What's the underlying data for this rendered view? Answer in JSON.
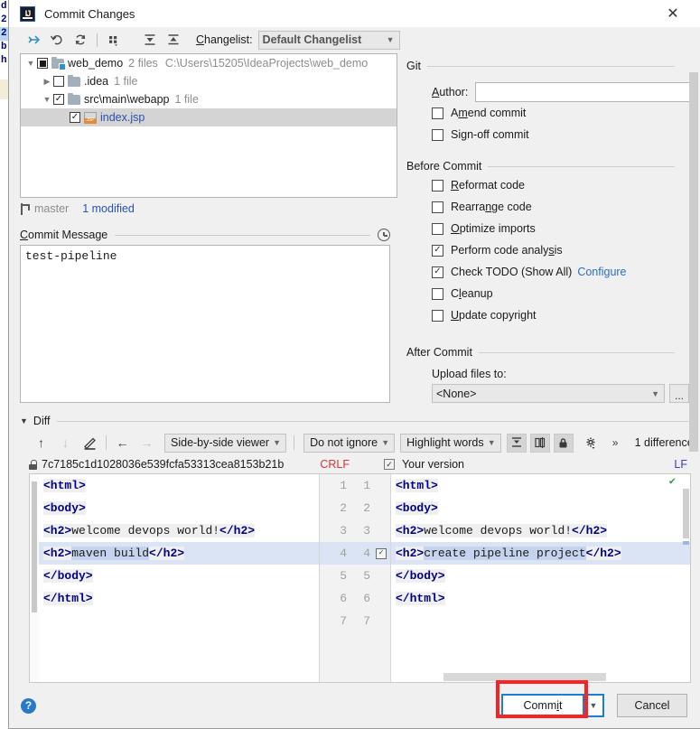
{
  "window": {
    "title": "Commit Changes",
    "app_icon": "intellij-idea-icon",
    "close_icon": "close-icon"
  },
  "background_editor": {
    "lines": [
      "d",
      "2",
      "2",
      "b",
      "h"
    ]
  },
  "toolbar": {
    "icons": [
      {
        "name": "expand-all-icon",
        "glyph": "include"
      },
      {
        "name": "rollback-icon",
        "glyph": "undo"
      },
      {
        "name": "refresh-icon",
        "glyph": "refresh"
      },
      {
        "name": "group-by-icon",
        "glyph": "group"
      },
      {
        "name": "expand-tree-icon",
        "glyph": "expand"
      },
      {
        "name": "collapse-tree-icon",
        "glyph": "collapse"
      }
    ],
    "changelist_label": "Changelist:",
    "changelist_accel": "C",
    "changelist_value": "Default Changelist"
  },
  "file_tree": {
    "rows": [
      {
        "indent": 0,
        "twisty": "v",
        "check": "partial",
        "icon": "folder-badge-icon",
        "name": "web_demo",
        "meta": "2 files",
        "path": "C:\\Users\\15205\\IdeaProjects\\web_demo",
        "selected": false,
        "link": false
      },
      {
        "indent": 1,
        "twisty": ">",
        "check": "off",
        "icon": "folder-icon",
        "name": ".idea",
        "meta": "1 file",
        "path": "",
        "selected": false,
        "link": false
      },
      {
        "indent": 1,
        "twisty": "v",
        "check": "on",
        "icon": "folder-icon",
        "name": "src\\main\\webapp",
        "meta": "1 file",
        "path": "",
        "selected": false,
        "link": false
      },
      {
        "indent": 2,
        "twisty": "",
        "check": "on",
        "icon": "jsp-file-icon",
        "name": "index.jsp",
        "meta": "",
        "path": "",
        "selected": true,
        "link": true
      }
    ]
  },
  "branch_bar": {
    "icon": "branch-icon",
    "branch": "master",
    "modified": "1 modified"
  },
  "commit_message": {
    "label": "Commit Message",
    "accel": "C",
    "history_icon": "clock-icon",
    "value": "test-pipeline"
  },
  "git_group": {
    "title": "Git",
    "author_label": "Author:",
    "author_accel": "A",
    "author_value": "",
    "options": [
      {
        "label": "Amend commit",
        "accel": "m",
        "checked": false,
        "name": "amend-commit-checkbox"
      },
      {
        "label": "Sign-off commit",
        "accel": "g",
        "checked": false,
        "name": "sign-off-commit-checkbox"
      }
    ]
  },
  "before_commit": {
    "title": "Before Commit",
    "options": [
      {
        "label": "Reformat code",
        "accel": "R",
        "checked": false,
        "name": "reformat-code-checkbox",
        "link": ""
      },
      {
        "label": "Rearrange code",
        "accel": "n",
        "checked": false,
        "name": "rearrange-code-checkbox",
        "link": ""
      },
      {
        "label": "Optimize imports",
        "accel": "O",
        "checked": false,
        "name": "optimize-imports-checkbox",
        "link": ""
      },
      {
        "label": "Perform code analysis",
        "accel": "s",
        "checked": true,
        "name": "perform-code-analysis-checkbox",
        "link": ""
      },
      {
        "label": "Check TODO (Show All)",
        "accel": "",
        "checked": true,
        "name": "check-todo-checkbox",
        "link": "Configure"
      },
      {
        "label": "Cleanup",
        "accel": "l",
        "checked": false,
        "name": "cleanup-checkbox",
        "link": ""
      },
      {
        "label": "Update copyright",
        "accel": "U",
        "checked": false,
        "name": "update-copyright-checkbox",
        "link": ""
      }
    ]
  },
  "after_commit": {
    "title": "After Commit",
    "upload_label": "Upload files to:",
    "upload_value": "<None>",
    "browse_label": "..."
  },
  "diff": {
    "section_label": "Diff",
    "toolbar": {
      "prev_icon": "arrow-up-icon",
      "next_icon": "arrow-down-icon",
      "edit_icon": "pencil-icon",
      "accept_left_icon": "arrow-left-icon",
      "accept_right_icon": "arrow-right-icon",
      "viewer_mode": "Side-by-side viewer",
      "ignore_mode": "Do not ignore",
      "highlight_mode": "Highlight words",
      "collapse_icon": "collapse-unchanged-icon",
      "sync_scroll_icon": "sync-scroll-icon",
      "lock_icon": "lock-icon",
      "settings_icon": "gear-icon",
      "overflow_icon": "chevron-double-right-icon",
      "difference_count": "1 difference"
    },
    "filebar": {
      "lock_icon": "lock-icon",
      "revision": "7c7185c1d1028036e539fcfa53313cea8153b21b",
      "left_sep": "CRLF",
      "your_version_checked": true,
      "your_version_label": "Your version",
      "right_sep": "LF"
    },
    "left_lines": [
      [
        {
          "t": "tag",
          "v": "<html>"
        }
      ],
      [
        {
          "t": "tag",
          "v": "<body>"
        }
      ],
      [
        {
          "t": "tag",
          "v": "<h2>"
        },
        {
          "t": "txt",
          "v": "welcome devops world!"
        },
        {
          "t": "tag",
          "v": "</h2>"
        }
      ],
      [
        {
          "t": "tag",
          "v": "<h2>"
        },
        {
          "t": "hl",
          "v": "maven build"
        },
        {
          "t": "tag",
          "v": "</h2>"
        }
      ],
      [
        {
          "t": "tag",
          "v": "</body>"
        }
      ],
      [
        {
          "t": "tag",
          "v": "</html>"
        }
      ]
    ],
    "right_lines": [
      [
        {
          "t": "tag",
          "v": "<html>"
        }
      ],
      [
        {
          "t": "tag",
          "v": "<body>"
        }
      ],
      [
        {
          "t": "tag",
          "v": "<h2>"
        },
        {
          "t": "txt",
          "v": "welcome devops world!"
        },
        {
          "t": "tag",
          "v": "</h2>"
        }
      ],
      [
        {
          "t": "tag",
          "v": "<h2>"
        },
        {
          "t": "hl",
          "v": "create pipeline project"
        },
        {
          "t": "tag",
          "v": "</h2>"
        }
      ],
      [
        {
          "t": "tag",
          "v": "</body>"
        }
      ],
      [
        {
          "t": "tag",
          "v": "</html>"
        }
      ]
    ],
    "line_numbers": [
      "1",
      "2",
      "3",
      "4",
      "5",
      "6",
      "7"
    ],
    "changed_line_index": 3
  },
  "footer": {
    "help_icon": "help-icon",
    "help_glyph": "?",
    "commit_label": "Commit",
    "commit_accel": "i",
    "commit_dropdown_icon": "chevron-down-icon",
    "cancel_label": "Cancel"
  },
  "colors": {
    "accent_blue": "#1a7fd4",
    "link_blue": "#2a6ec0",
    "annotation_red": "#fb2222",
    "crlf_red": "#d63535",
    "lf_blue": "#3b3bc9",
    "selection_blue": "#dbe4f5",
    "dialog_bg": "#f0f0f0"
  },
  "annotation": {
    "name": "highlight-rectangle",
    "target": "commit-button"
  }
}
